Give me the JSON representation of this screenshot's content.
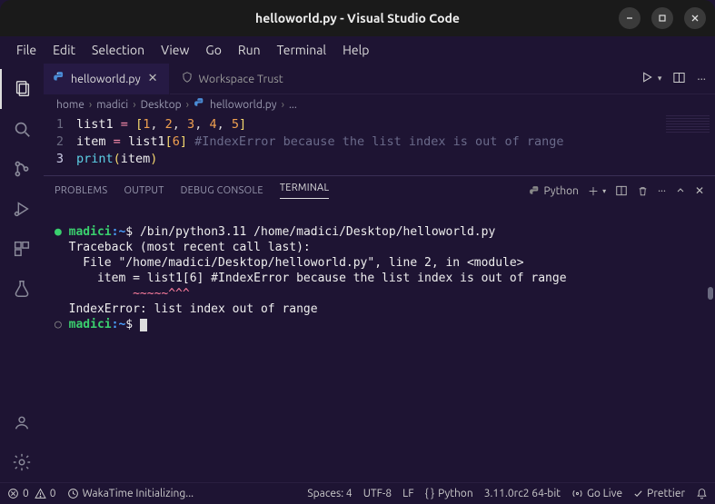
{
  "window": {
    "title": "helloworld.py - Visual Studio Code"
  },
  "menubar": [
    "File",
    "Edit",
    "Selection",
    "View",
    "Go",
    "Run",
    "Terminal",
    "Help"
  ],
  "tabs": {
    "active_file": "helloworld.py",
    "trust_label": "Workspace Trust"
  },
  "breadcrumbs": {
    "parts": [
      "home",
      "madici",
      "Desktop"
    ],
    "file": "helloworld.py",
    "tail": "..."
  },
  "editor": {
    "lines": [
      {
        "n": "1",
        "raw": "list1 = [1, 2, 3, 4, 5]"
      },
      {
        "n": "2",
        "raw": "item = list1[6] #IndexError because the list index is out of range"
      },
      {
        "n": "3",
        "raw": "print(item)"
      }
    ]
  },
  "panel": {
    "tabs": [
      "PROBLEMS",
      "OUTPUT",
      "DEBUG CONSOLE",
      "TERMINAL"
    ],
    "active": "TERMINAL",
    "launcher": "Python"
  },
  "terminal": {
    "prompt_host": "madici",
    "prompt_path1": "~",
    "prompt_path2": "~",
    "command": "/bin/python3.11 /home/madici/Desktop/helloworld.py",
    "lines": [
      "  Traceback (most recent call last):",
      "    File \"/home/madici/Desktop/helloworld.py\", line 2, in <module>",
      "      item = list1[6] #IndexError because the list index is out of range",
      "           ~~~~~^^^",
      "  IndexError: list index out of range"
    ]
  },
  "statusbar": {
    "errors": "0",
    "warnings": "0",
    "waka": "WakaTime Initializing...",
    "spaces": "Spaces: 4",
    "encoding": "UTF-8",
    "eol": "LF",
    "lang": "Python",
    "pyver": "3.11.0rc2 64-bit",
    "golive": "Go Live",
    "prettier": "Prettier"
  }
}
